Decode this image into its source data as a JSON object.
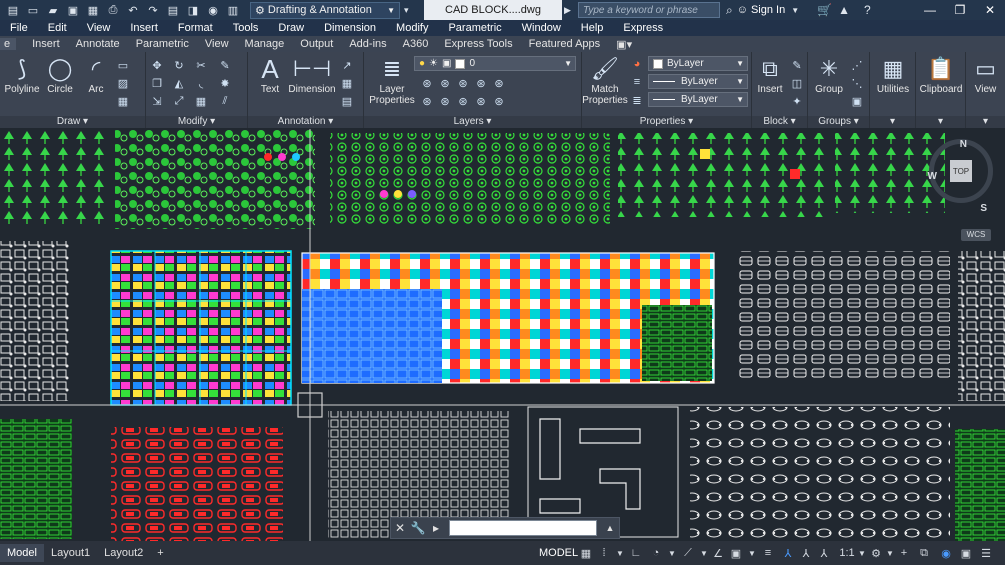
{
  "titlebar": {
    "workspace": "Drafting & Annotation",
    "document": "CAD BLOCK....dwg",
    "search_placeholder": "Type a keyword or phrase",
    "signin": "Sign In"
  },
  "menu": [
    "File",
    "Edit",
    "View",
    "Insert",
    "Format",
    "Tools",
    "Draw",
    "Dimension",
    "Modify",
    "Parametric",
    "Window",
    "Help",
    "Express"
  ],
  "ribbon_tabs": [
    "Insert",
    "Annotate",
    "Parametric",
    "View",
    "Manage",
    "Output",
    "Add-ins",
    "A360",
    "Express Tools",
    "Featured Apps"
  ],
  "ribbon": {
    "draw": {
      "title": "Draw",
      "polyline": "Polyline",
      "circle": "Circle",
      "arc": "Arc"
    },
    "modify": {
      "title": "Modify"
    },
    "annotation": {
      "title": "Annotation",
      "text": "Text",
      "dimension": "Dimension"
    },
    "layers": {
      "title": "Layers",
      "layer_properties": "Layer\nProperties",
      "layer_value": "0"
    },
    "properties": {
      "title": "Properties",
      "match_properties": "Match\nProperties",
      "color": "ByLayer",
      "linetype": "ByLayer",
      "lineweight": "ByLayer"
    },
    "block": {
      "title": "Block",
      "insert": "Insert"
    },
    "groups": {
      "title": "Groups",
      "group": "Group"
    },
    "utilities": "Utilities",
    "clipboard": "Clipboard",
    "view": "View"
  },
  "viewcube": {
    "north": "N",
    "south": "S",
    "west": "W",
    "face": "TOP",
    "wcs": "WCS"
  },
  "statusbar": {
    "tabs": [
      "Model",
      "Layout1",
      "Layout2"
    ],
    "add_tab": "+",
    "model_label": "MODEL",
    "scale": "1:1"
  },
  "colors": {
    "background": "#212830",
    "ribbon": "#3c4452",
    "titlebar": "#24364c",
    "menubar": "#22324a"
  }
}
